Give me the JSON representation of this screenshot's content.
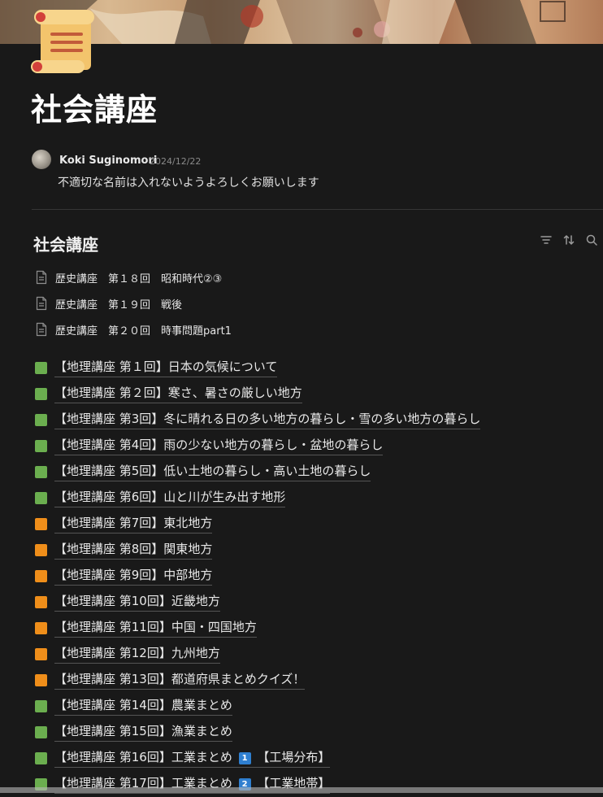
{
  "page": {
    "title": "社会講座"
  },
  "comment": {
    "author": "Koki Suginomori",
    "date": "2024/12/22",
    "text": "不適切な名前は入れないようよろしくお願いします"
  },
  "database": {
    "title": "社会講座",
    "tools": [
      "filter-icon",
      "sort-icon",
      "search-icon"
    ],
    "pages": [
      "歴史講座　第１８回　昭和時代②③",
      "歴史講座　第１９回　戦後",
      "歴史講座　第２０回　時事問題part1"
    ]
  },
  "items": [
    {
      "color": "green",
      "text": "【地理講座 第１回】日本の気候について"
    },
    {
      "color": "green",
      "text": "【地理講座 第２回】寒さ、暑さの厳しい地方"
    },
    {
      "color": "green",
      "text": "【地理講座 第3回】冬に晴れる日の多い地方の暮らし・雪の多い地方の暮らし"
    },
    {
      "color": "green",
      "text": "【地理講座 第4回】雨の少ない地方の暮らし・盆地の暮らし"
    },
    {
      "color": "green",
      "text": "【地理講座 第5回】低い土地の暮らし・高い土地の暮らし"
    },
    {
      "color": "green",
      "text": "【地理講座 第6回】山と川が生み出す地形"
    },
    {
      "color": "orange",
      "text": "【地理講座 第7回】東北地方"
    },
    {
      "color": "orange",
      "text": "【地理講座 第8回】関東地方"
    },
    {
      "color": "orange",
      "text": "【地理講座 第9回】中部地方"
    },
    {
      "color": "orange",
      "text": "【地理講座 第10回】近畿地方"
    },
    {
      "color": "orange",
      "text": "【地理講座 第11回】中国・四国地方"
    },
    {
      "color": "orange",
      "text": "【地理講座 第12回】九州地方"
    },
    {
      "color": "orange",
      "text": "【地理講座 第13回】都道府県まとめクイズ！"
    },
    {
      "color": "green",
      "text": "【地理講座 第14回】農業まとめ"
    },
    {
      "color": "green",
      "text": "【地理講座 第15回】漁業まとめ"
    },
    {
      "color": "green",
      "text": "【地理講座 第16回】工業まとめ",
      "badge": "1",
      "suffix": "【工場分布】"
    },
    {
      "color": "green",
      "text": "【地理講座 第17回】工業まとめ",
      "badge": "2",
      "suffix": "【工業地帯】"
    }
  ],
  "colors": {
    "green": "#6bae4f",
    "orange": "#ef8e1a",
    "badge": "#2f7fd0"
  }
}
